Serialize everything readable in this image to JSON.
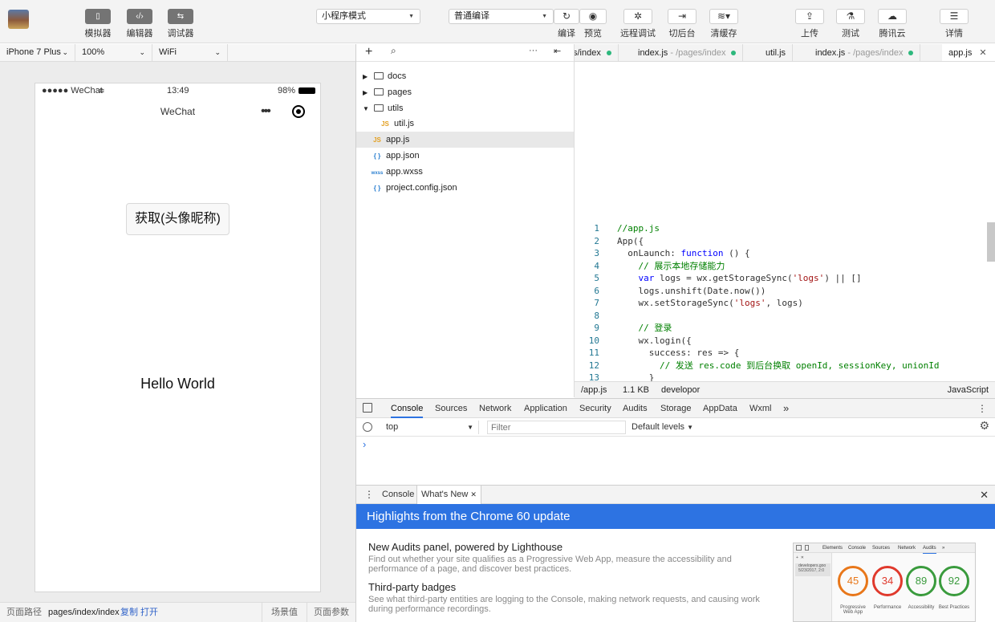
{
  "toolbar": {
    "buttons": [
      {
        "label": "模拟器",
        "icon": "phone-icon"
      },
      {
        "label": "编辑器",
        "icon": "code-icon"
      },
      {
        "label": "调试器",
        "icon": "debug-icon"
      }
    ],
    "mode_select": "小程序模式",
    "compile_select": "普通编译",
    "actions": [
      {
        "label": "编译",
        "icon": "refresh-icon"
      },
      {
        "label": "预览",
        "icon": "eye-icon"
      },
      {
        "label": "远程调试",
        "icon": "bug-icon"
      },
      {
        "label": "切后台",
        "icon": "switch-icon"
      },
      {
        "label": "清缓存",
        "icon": "layers-icon"
      },
      {
        "label": "上传",
        "icon": "upload-icon"
      },
      {
        "label": "测试",
        "icon": "flask-icon"
      },
      {
        "label": "腾讯云",
        "icon": "cloud-icon"
      },
      {
        "label": "详情",
        "icon": "menu-icon"
      }
    ]
  },
  "simulator": {
    "device": "iPhone 7 Plus",
    "zoom": "100%",
    "network": "WiFi",
    "statusbar": {
      "carrier": "●●●●● WeChat",
      "time": "13:49",
      "battery": "98%"
    },
    "navbar_title": "WeChat",
    "button_label": "获取(头像昵称)",
    "hello": "Hello World"
  },
  "bottombar": {
    "path_label": "页面路径",
    "path": "pages/index/index",
    "copy": "复制",
    "open": "打开",
    "scene": "场景值",
    "params": "页面参数"
  },
  "explorer": {
    "items": [
      {
        "name": "docs",
        "type": "folder",
        "collapsed": true
      },
      {
        "name": "pages",
        "type": "folder",
        "collapsed": true
      },
      {
        "name": "utils",
        "type": "folder",
        "collapsed": false
      },
      {
        "name": "util.js",
        "type": "js"
      },
      {
        "name": "app.js",
        "type": "js",
        "selected": true
      },
      {
        "name": "app.json",
        "type": "json"
      },
      {
        "name": "app.wxss",
        "type": "wxss"
      },
      {
        "name": "project.config.json",
        "type": "json"
      }
    ],
    "file_badges": {
      "js": "JS",
      "json": "{ }",
      "wxss": "wxss"
    }
  },
  "tabs": [
    {
      "name": "s/index",
      "path": "",
      "dot": true
    },
    {
      "name": "index.js",
      "path": " - /pages/index",
      "dot": true
    },
    {
      "name": "util.js",
      "path": "",
      "dot": false
    },
    {
      "name": "index.js",
      "path": " - /pages/index",
      "dot": true
    },
    {
      "name": "app.js",
      "path": "",
      "dot": false,
      "close": "✕"
    }
  ],
  "code_lines": [
    "//app.js",
    "App({",
    "  onLaunch: function () {",
    "    // 展示本地存储能力",
    "    var logs = wx.getStorageSync('logs') || []",
    "    logs.unshift(Date.now())",
    "    wx.setStorageSync('logs', logs)",
    "",
    "    // 登录",
    "    wx.login({",
    "      success: res => {",
    "        // 发送 res.code 到后台换取 openId, sessionKey, unionId",
    "      }"
  ],
  "status": {
    "file": "/app.js",
    "size": "1.1 KB",
    "branch": "developor",
    "lang": "JavaScript"
  },
  "devtools": {
    "tabs": [
      "Console",
      "Sources",
      "Network",
      "Application",
      "Security",
      "Audits",
      "Storage",
      "AppData",
      "Wxml"
    ],
    "more": "»",
    "context": "top",
    "filter_placeholder": "Filter",
    "levels": "Default levels",
    "prompt": "›"
  },
  "drawer": {
    "tabs": [
      "Console",
      "What's New"
    ],
    "close": "✕"
  },
  "whatsnew": {
    "banner": "Highlights from the Chrome 60 update",
    "items": [
      {
        "title": "New Audits panel, powered by Lighthouse",
        "desc": "Find out whether your site qualifies as a Progressive Web App, measure the accessibility and performance of a page, and discover best practices."
      },
      {
        "title": "Third-party badges",
        "desc": "See what third-party entities are logging to the Console, making network requests, and causing work during performance recordings."
      }
    ],
    "thumb": {
      "tabs": [
        "Elements",
        "Console",
        "Sources",
        "Network",
        "Audits",
        "»"
      ],
      "side": "developers.goo",
      "side_date": "5/23/2017, 2:0",
      "scores": [
        {
          "value": "45",
          "label": "Progressive Web App",
          "color": "#e8771a"
        },
        {
          "value": "34",
          "label": "Performance",
          "color": "#e0392c"
        },
        {
          "value": "89",
          "label": "Accessibility",
          "color": "#3a9b3d"
        },
        {
          "value": "92",
          "label": "Best Practices",
          "color": "#3a9b3d"
        }
      ]
    }
  }
}
